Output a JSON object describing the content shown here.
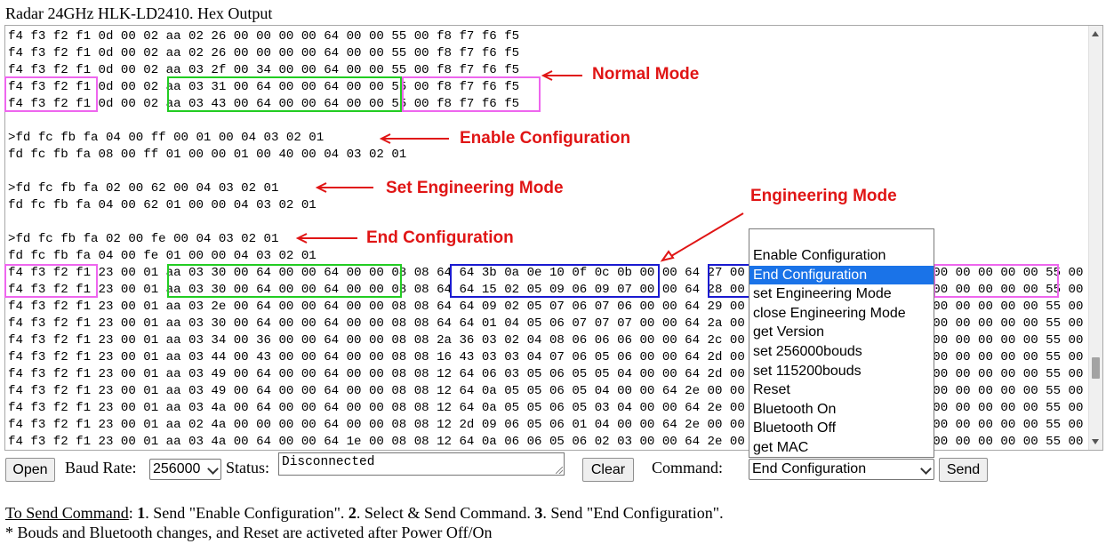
{
  "title": "Radar 24GHz HLK-LD2410. Hex Output",
  "hex_lines": [
    "f4 f3 f2 f1 0d 00 02 aa 02 26 00 00 00 00 64 00 00 55 00 f8 f7 f6 f5",
    "f4 f3 f2 f1 0d 00 02 aa 02 26 00 00 00 00 64 00 00 55 00 f8 f7 f6 f5",
    "f4 f3 f2 f1 0d 00 02 aa 03 2f 00 34 00 00 64 00 00 55 00 f8 f7 f6 f5",
    "f4 f3 f2 f1 0d 00 02 aa 03 31 00 64 00 00 64 00 00 55 00 f8 f7 f6 f5",
    "f4 f3 f2 f1 0d 00 02 aa 03 43 00 64 00 00 64 00 00 55 00 f8 f7 f6 f5",
    "",
    ">fd fc fb fa 04 00 ff 00 01 00 04 03 02 01",
    "fd fc fb fa 08 00 ff 01 00 00 01 00 40 00 04 03 02 01",
    "",
    ">fd fc fb fa 02 00 62 00 04 03 02 01",
    "fd fc fb fa 04 00 62 01 00 00 04 03 02 01",
    "",
    ">fd fc fb fa 02 00 fe 00 04 03 02 01",
    "fd fc fb fa 04 00 fe 01 00 00 04 03 02 01",
    "f4 f3 f2 f1 23 00 01 aa 03 30 00 64 00 00 64 00 00 08 08 64 64 3b 0a 0e 10 0f 0c 0b 00 00 64 27 00 00 00 00 00 00 00 00 00 00 00 00 00 00 55 00 f8 f7 f6 f5",
    "f4 f3 f2 f1 23 00 01 aa 03 30 00 64 00 00 64 00 00 08 08 64 64 15 02 05 09 06 09 07 00 00 64 28 00 00 00 00 00 00 00 00 00 00 00 00 00 00 55 00 f8 f7 f6 f5",
    "f4 f3 f2 f1 23 00 01 aa 03 2e 00 64 00 00 64 00 00 08 08 64 64 09 02 05 07 06 07 06 00 00 64 29 00 00 00 00 00 00 00 00 00 00 00 00 00 00 55 00 f8 f7 f6 f5",
    "f4 f3 f2 f1 23 00 01 aa 03 30 00 64 00 00 64 00 00 08 08 64 64 01 04 05 06 07 07 07 00 00 64 2a 00 00 00 00 00 00 00 00 00 00 00 00 00 00 55 00 f8 f7 f6 f5",
    "f4 f3 f2 f1 23 00 01 aa 03 34 00 36 00 00 64 00 00 08 08 2a 36 03 02 04 08 06 06 06 00 00 64 2c 00 00 00 00 00 00 00 00 00 00 00 00 00 00 55 00 f8 f7 f6 f5",
    "f4 f3 f2 f1 23 00 01 aa 03 44 00 43 00 00 64 00 00 08 08 16 43 03 03 04 07 06 05 06 00 00 64 2d 00 00 00 00 00 00 00 00 00 00 00 00 00 00 55 00 f8 f7 f6 f5",
    "f4 f3 f2 f1 23 00 01 aa 03 49 00 64 00 00 64 00 00 08 08 12 64 06 03 05 06 05 05 04 00 00 64 2d 00 00 00 00 00 00 00 00 00 00 00 00 00 00 55 00 f8 f7 f6 f5",
    "f4 f3 f2 f1 23 00 01 aa 03 49 00 64 00 00 64 00 00 08 08 12 64 0a 05 05 06 05 04 00 00 64 2e 00 00 00 00 00 00 00 00 00 00 00 00 00 00 00 55 00 f8 f7 f6 f5",
    "f4 f3 f2 f1 23 00 01 aa 03 4a 00 64 00 00 64 00 00 08 08 12 64 0a 05 05 06 05 03 04 00 00 64 2e 00 00 00 00 00 00 00 00 00 00 00 00 00 00 55 00 f8 f7 f6 f5",
    "f4 f3 f2 f1 23 00 01 aa 02 4a 00 00 00 00 64 00 00 08 08 12 2d 09 06 05 06 01 04 00 00 64 2e 00 00 00 00 00 00 00 00 00 00 00 00 00 00 00 55 00 f8 f7 f6 f5",
    "f4 f3 f2 f1 23 00 01 aa 03 4a 00 64 00 00 64 1e 00 08 08 12 64 0a 06 06 05 06 02 03 00 00 64 2e 00 00 00 00 00 00 00 00 00 00 00 00 00 00 55 00 f8 f7 f6 f5"
  ],
  "annotations": {
    "normal_mode": "Normal Mode",
    "enable_configuration": "Enable Configuration",
    "set_engineering_mode": "Set Engineering Mode",
    "end_configuration": "End Configuration",
    "engineering_mode": "Engineering Mode"
  },
  "annotation_color": "#e01515",
  "box_colors": {
    "header": "#ee66ee",
    "data": "#22cc22",
    "engineering": "#1a1ad0"
  },
  "command_dropdown": {
    "options": [
      "Enable Configuration",
      "End Configuration",
      "set Engineering Mode",
      "close Engineering Mode",
      "get Version",
      "set 256000bouds",
      "set 115200bouds",
      "Reset",
      "Bluetooth On",
      "Bluetooth Off",
      "get MAC"
    ],
    "highlighted": "End Configuration"
  },
  "controls": {
    "open_label": "Open",
    "baud_rate_label": "Baud Rate:",
    "baud_rate_value": "256000",
    "status_label": "Status:",
    "status_value": "Disconnected",
    "clear_label": "Clear",
    "command_label": "Command:",
    "command_value": "End Configuration",
    "send_label": "Send"
  },
  "instructions": {
    "line1": {
      "heading": "To Send Command",
      "colon": ": ",
      "step1_num": "1",
      "step1_text": ". Send \"Enable Configuration\". ",
      "step2_num": "2",
      "step2_text": ". Select & Send Command. ",
      "step3_num": "3",
      "step3_text": ". Send \"End Configuration\"."
    },
    "line2": "* Bouds and Bluetooth changes, and Reset are activeted after Power Off/On"
  }
}
